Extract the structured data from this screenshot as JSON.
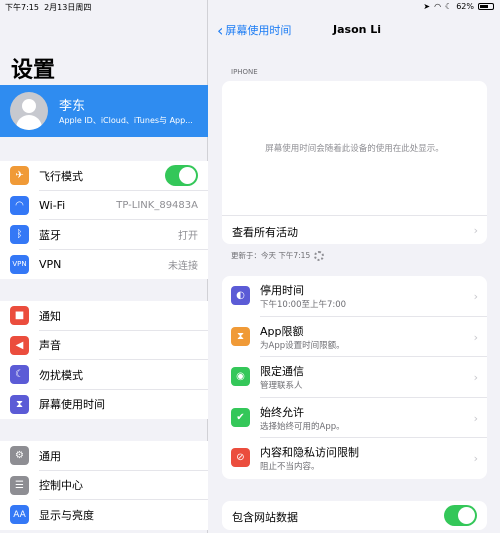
{
  "status": {
    "time": "下午7:15",
    "date": "2月13日周四",
    "battery": "62%"
  },
  "left": {
    "title": "设置",
    "profile": {
      "name": "李东",
      "sub": "Apple ID、iCloud、iTunes与 App..."
    },
    "group1": [
      {
        "label": "飞行模式",
        "value": "",
        "icon": "airplane-icon",
        "color": "#f09a37"
      },
      {
        "label": "Wi-Fi",
        "value": "TP-LINK_89483A",
        "icon": "wifi-icon",
        "color": "#3478f6"
      },
      {
        "label": "蓝牙",
        "value": "打开",
        "icon": "bluetooth-icon",
        "color": "#3478f6"
      },
      {
        "label": "VPN",
        "value": "未连接",
        "icon": "vpn-icon",
        "color": "#3478f6"
      }
    ],
    "group2": [
      {
        "label": "通知",
        "icon": "notifications-icon",
        "color": "#eb4d3d"
      },
      {
        "label": "声音",
        "icon": "sound-icon",
        "color": "#eb4d3d"
      },
      {
        "label": "勿扰模式",
        "icon": "moon-icon",
        "color": "#5b5bd6"
      },
      {
        "label": "屏幕使用时间",
        "icon": "hourglass-icon",
        "color": "#5b5bd6"
      }
    ],
    "group3": [
      {
        "label": "通用",
        "icon": "gear-icon",
        "color": "#8e8e93"
      },
      {
        "label": "控制中心",
        "icon": "switches-icon",
        "color": "#8e8e93"
      },
      {
        "label": "显示与亮度",
        "icon": "display-icon",
        "color": "#3478f6"
      }
    ]
  },
  "right": {
    "back": "屏幕使用时间",
    "title": "Jason Li",
    "section": "IPHONE",
    "info": "屏幕使用时间会随着此设备的使用在此处显示。",
    "all_activity": "查看所有活动",
    "updated": "更新于：今天 下午7:15",
    "features": [
      {
        "title": "停用时间",
        "sub": "下午10:00至上午7:00",
        "icon": "downtime-icon",
        "color": "#5b5bd6"
      },
      {
        "title": "App限额",
        "sub": "为App设置时间限额。",
        "icon": "hourglass-icon",
        "color": "#f09a37"
      },
      {
        "title": "限定通信",
        "sub": "管理联系人",
        "icon": "contacts-icon",
        "color": "#34c759"
      },
      {
        "title": "始终允许",
        "sub": "选择始终可用的App。",
        "icon": "checkmark-icon",
        "color": "#34c759"
      },
      {
        "title": "内容和隐私访问限制",
        "sub": "阻止不当内容。",
        "icon": "restrictions-icon",
        "color": "#eb4d3d"
      }
    ],
    "website_data": "包含网站数据"
  }
}
